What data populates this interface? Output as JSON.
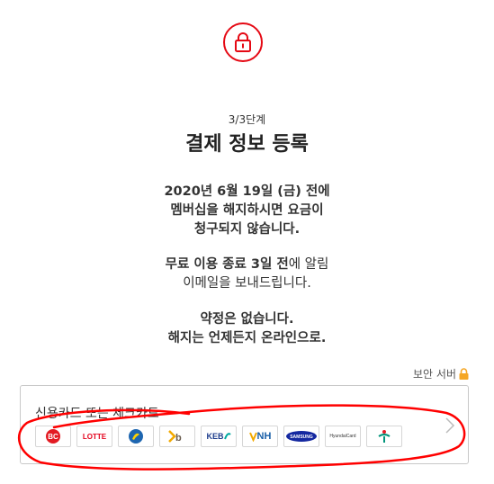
{
  "header": {
    "lock_icon": "lock-icon",
    "accent": "#e50914",
    "step": "3/3단계",
    "title": "결제 정보 등록"
  },
  "info": {
    "line1": "2020년 6월 19일 (금) 전에",
    "line2": "멤버십을 해지하시면 요금이",
    "line3": "청구되지 않습니다.",
    "reminder_bold": "무료 이용 종료 3일 전",
    "reminder_rest": "에 알림",
    "reminder_line2": "이메일을 보내드립니다.",
    "nocommit1": "약정은 없습니다.",
    "nocommit2": "해지는 언제든지 온라인으로."
  },
  "secure": {
    "label": "보안 서버",
    "icon": "padlock-icon",
    "icon_color": "#f5a623"
  },
  "payment": {
    "label": "신용카드 또는 체크카드",
    "chevron_icon": "chevron-right-icon",
    "logos": [
      {
        "name": "bc-card-logo",
        "text": "BC",
        "color": "#e31b23"
      },
      {
        "name": "lotte-card-logo",
        "text": "LOTTE",
        "color": "#e4001b"
      },
      {
        "name": "kb-kookmin-logo",
        "text": "",
        "color": "#1e66b0"
      },
      {
        "name": "kb-card-logo",
        "text": "",
        "color": "#f2a900"
      },
      {
        "name": "keb-card-logo",
        "text": "KEB",
        "color": "#1d3c8c"
      },
      {
        "name": "nh-card-logo",
        "text": "NH",
        "color": "#1a5fa8"
      },
      {
        "name": "samsung-card-logo",
        "text": "SAMSUNG",
        "color": "#1428a0"
      },
      {
        "name": "hyundai-card-logo",
        "text": "HyundaiCard",
        "color": "#333333"
      },
      {
        "name": "hana-card-logo",
        "text": "",
        "color": "#00947a"
      }
    ]
  },
  "annotation": {
    "color": "#ff0000"
  }
}
